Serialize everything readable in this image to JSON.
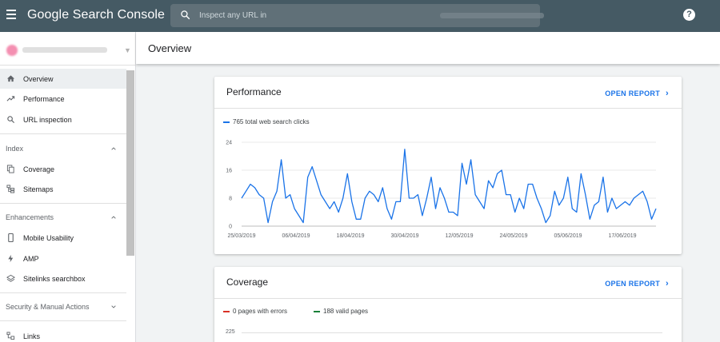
{
  "app": {
    "title": "Google Search Console",
    "search_placeholder": "Inspect any URL in"
  },
  "sidebar": {
    "items": [
      {
        "label": "Overview",
        "icon": "home-icon",
        "active": true
      },
      {
        "label": "Performance",
        "icon": "trending-up-icon"
      },
      {
        "label": "URL inspection",
        "icon": "search-icon"
      }
    ],
    "sections": [
      {
        "label": "Index",
        "items": [
          {
            "label": "Coverage",
            "icon": "file-copy-icon"
          },
          {
            "label": "Sitemaps",
            "icon": "sitemap-icon"
          }
        ]
      },
      {
        "label": "Enhancements",
        "items": [
          {
            "label": "Mobile Usability",
            "icon": "smartphone-icon"
          },
          {
            "label": "AMP",
            "icon": "bolt-icon"
          },
          {
            "label": "Sitelinks searchbox",
            "icon": "layers-icon"
          }
        ]
      },
      {
        "label": "Security & Manual Actions"
      }
    ],
    "bottom_items": [
      {
        "label": "Links",
        "icon": "links-icon"
      }
    ]
  },
  "page": {
    "title": "Overview"
  },
  "performance_card": {
    "title": "Performance",
    "open_report": "OPEN REPORT",
    "legend": "765 total web search clicks",
    "color": "#1a73e8"
  },
  "coverage_card": {
    "title": "Coverage",
    "open_report": "OPEN REPORT",
    "legend_errors": "0 pages with errors",
    "legend_valid": "188 valid pages",
    "error_color": "#d93025",
    "valid_color": "#188038",
    "y_top": "225"
  },
  "chart_data": {
    "type": "line",
    "title": "",
    "series": [
      {
        "name": "765 total web search clicks",
        "values": [
          8,
          10,
          12,
          11,
          9,
          8,
          1,
          7,
          10,
          19,
          8,
          9,
          5,
          3,
          1,
          14,
          17,
          13,
          9,
          7,
          5,
          7,
          4,
          8,
          15,
          7,
          2,
          2,
          8,
          10,
          9,
          7,
          11,
          5,
          2,
          7,
          7,
          22,
          8,
          8,
          9,
          3,
          8,
          14,
          5,
          11,
          8,
          4,
          4,
          3,
          18,
          12,
          19,
          9,
          7,
          5,
          13,
          11,
          15,
          16,
          9,
          9,
          4,
          8,
          5,
          12,
          12,
          8,
          5,
          1,
          3,
          10,
          6,
          8,
          14,
          5,
          4,
          15,
          9,
          2,
          6,
          7,
          14,
          4,
          8,
          5,
          6,
          7,
          6,
          8,
          9,
          10,
          7,
          2,
          5
        ]
      }
    ],
    "x_tick_labels": [
      "25/03/2019",
      "06/04/2019",
      "18/04/2019",
      "30/04/2019",
      "12/05/2019",
      "24/05/2019",
      "05/06/2019",
      "17/06/2019"
    ],
    "y_tick_labels": [
      "0",
      "8",
      "16",
      "24"
    ],
    "ylim": [
      0,
      24
    ],
    "grid": true,
    "color": "#1a73e8"
  }
}
